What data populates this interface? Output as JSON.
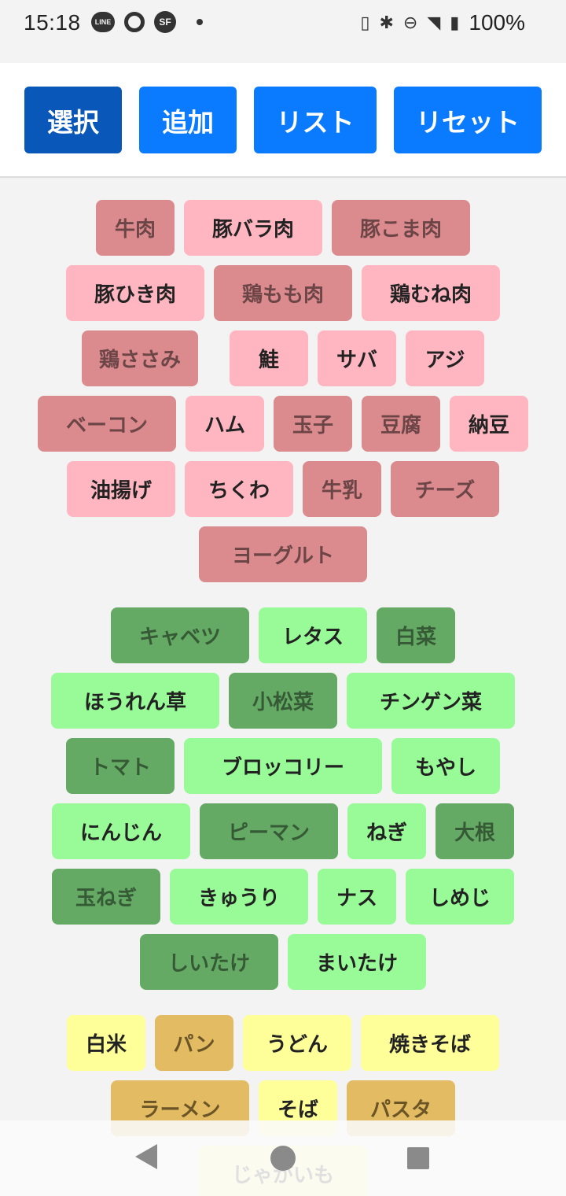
{
  "status": {
    "time": "15:18",
    "battery": "100%",
    "icons": [
      "line-app-icon",
      "chrome-icon",
      "sf-app-icon",
      "notification-dot",
      "vibrate-icon",
      "bluetooth-icon",
      "dnd-icon",
      "wifi-icon",
      "battery-icon"
    ],
    "line_label": "LINE",
    "sf_label": "SF"
  },
  "toolbar": {
    "select_label": "選択",
    "add_label": "追加",
    "list_label": "リスト",
    "reset_label": "リセット",
    "active_color": "#0957b8",
    "button_color": "#0a7aff"
  },
  "meat": {
    "color": "#ffb6c1",
    "selected_color": "#db8a8e",
    "items": [
      "牛肉",
      "豚バラ肉",
      "豚こま肉",
      "豚ひき肉",
      "鶏もも肉",
      "鶏むね肉",
      "鶏ささみ",
      "鮭",
      "サバ",
      "アジ",
      "ベーコン",
      "ハム",
      "玉子",
      "豆腐",
      "納豆",
      "油揚げ",
      "ちくわ",
      "牛乳",
      "チーズ",
      "ヨーグルト"
    ],
    "selected": [
      true,
      false,
      true,
      false,
      true,
      false,
      true,
      false,
      false,
      false,
      true,
      false,
      true,
      true,
      false,
      false,
      false,
      true,
      true,
      true
    ]
  },
  "veg": {
    "color": "#98fb98",
    "selected_color": "#64aa64",
    "items": [
      "キャベツ",
      "レタス",
      "白菜",
      "ほうれん草",
      "小松菜",
      "チンゲン菜",
      "トマト",
      "ブロッコリー",
      "もやし",
      "にんじん",
      "ピーマン",
      "ねぎ",
      "大根",
      "玉ねぎ",
      "きゅうり",
      "ナス",
      "しめじ",
      "しいたけ",
      "まいたけ"
    ],
    "selected": [
      true,
      false,
      true,
      false,
      true,
      false,
      true,
      false,
      false,
      false,
      true,
      false,
      true,
      true,
      false,
      false,
      false,
      true,
      false
    ]
  },
  "grain": {
    "color": "#ffff99",
    "selected_color": "#e2bb62",
    "items": [
      "白米",
      "パン",
      "うどん",
      "焼きそば",
      "ラーメン",
      "そば",
      "パスタ",
      "じゃがいも"
    ],
    "selected": [
      false,
      true,
      false,
      false,
      true,
      false,
      true,
      false
    ]
  },
  "nav": {
    "back": "back-icon",
    "home": "home-icon",
    "recent": "recent-apps-icon"
  }
}
